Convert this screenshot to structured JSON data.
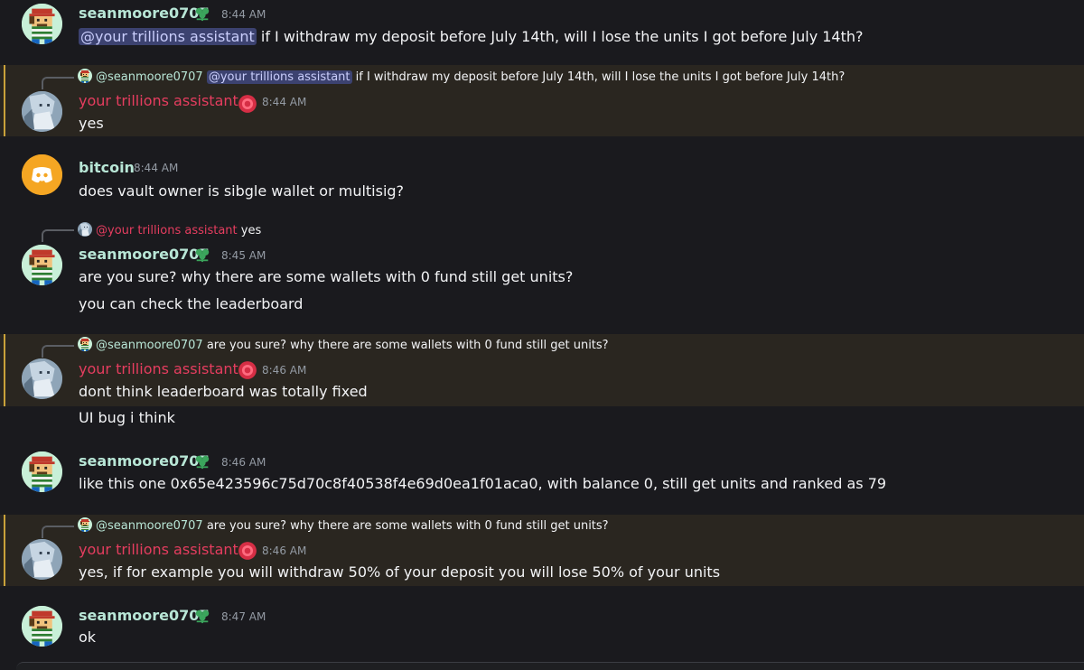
{
  "messages": {
    "m1": {
      "author": "seanmoore0707",
      "time": "8:44 AM",
      "mention": "@your trillions assistant",
      "text": " if I withdraw my deposit before July 14th, will I lose the units I got before July 14th?"
    },
    "m2": {
      "reply_user": "@seanmoore0707",
      "reply_mention": "@your trillions assistant",
      "reply_text": " if I withdraw my deposit before July 14th, will I lose the units I got before July 14th?",
      "author": "your trillions assistant",
      "time": "8:44 AM",
      "text": "yes"
    },
    "m3": {
      "author": "bitcoin",
      "time": "8:44 AM",
      "text": "does vault owner is sibgle wallet or multisig?"
    },
    "m4": {
      "reply_user": "@your trillions assistant",
      "reply_text": "yes",
      "author": "seanmoore0707",
      "time": "8:45 AM",
      "text": "are you sure? why there are some wallets with 0 fund still get units?",
      "text2": "you can check the leaderboard"
    },
    "m5": {
      "reply_user": "@seanmoore0707",
      "reply_text": "are you sure? why there are some wallets with 0 fund still get units?",
      "author": "your trillions assistant",
      "time": "8:46 AM",
      "text": "dont think leaderboard was totally fixed",
      "text2": "UI bug i think"
    },
    "m6": {
      "author": "seanmoore0707",
      "time": "8:46 AM",
      "text": "like this one 0x65e423596c75d70c8f40538f4e69d0ea1f01aca0, with balance 0, still get units and ranked as 79"
    },
    "m7": {
      "reply_user": "@seanmoore0707",
      "reply_text": "are you sure? why there are some wallets with 0 fund still get units?",
      "author": "your trillions assistant",
      "time": "8:46 AM",
      "text": "yes, if for example you will withdraw 50% of your deposit you will lose 50% of your units"
    },
    "m8": {
      "author": "seanmoore0707",
      "time": "8:47 AM",
      "text": "ok"
    }
  },
  "colors": {
    "background": "#1a1a1e",
    "highlight": "#2a2620",
    "sean_name": "#b8e6d6",
    "assistant_name": "#e53d5f",
    "mention_bg": "#3c4270"
  },
  "icons": {
    "sean_badge": "green-clover-icon",
    "assistant_badge": "red-orb-icon",
    "bitcoin_avatar": "discord-logo-icon"
  }
}
